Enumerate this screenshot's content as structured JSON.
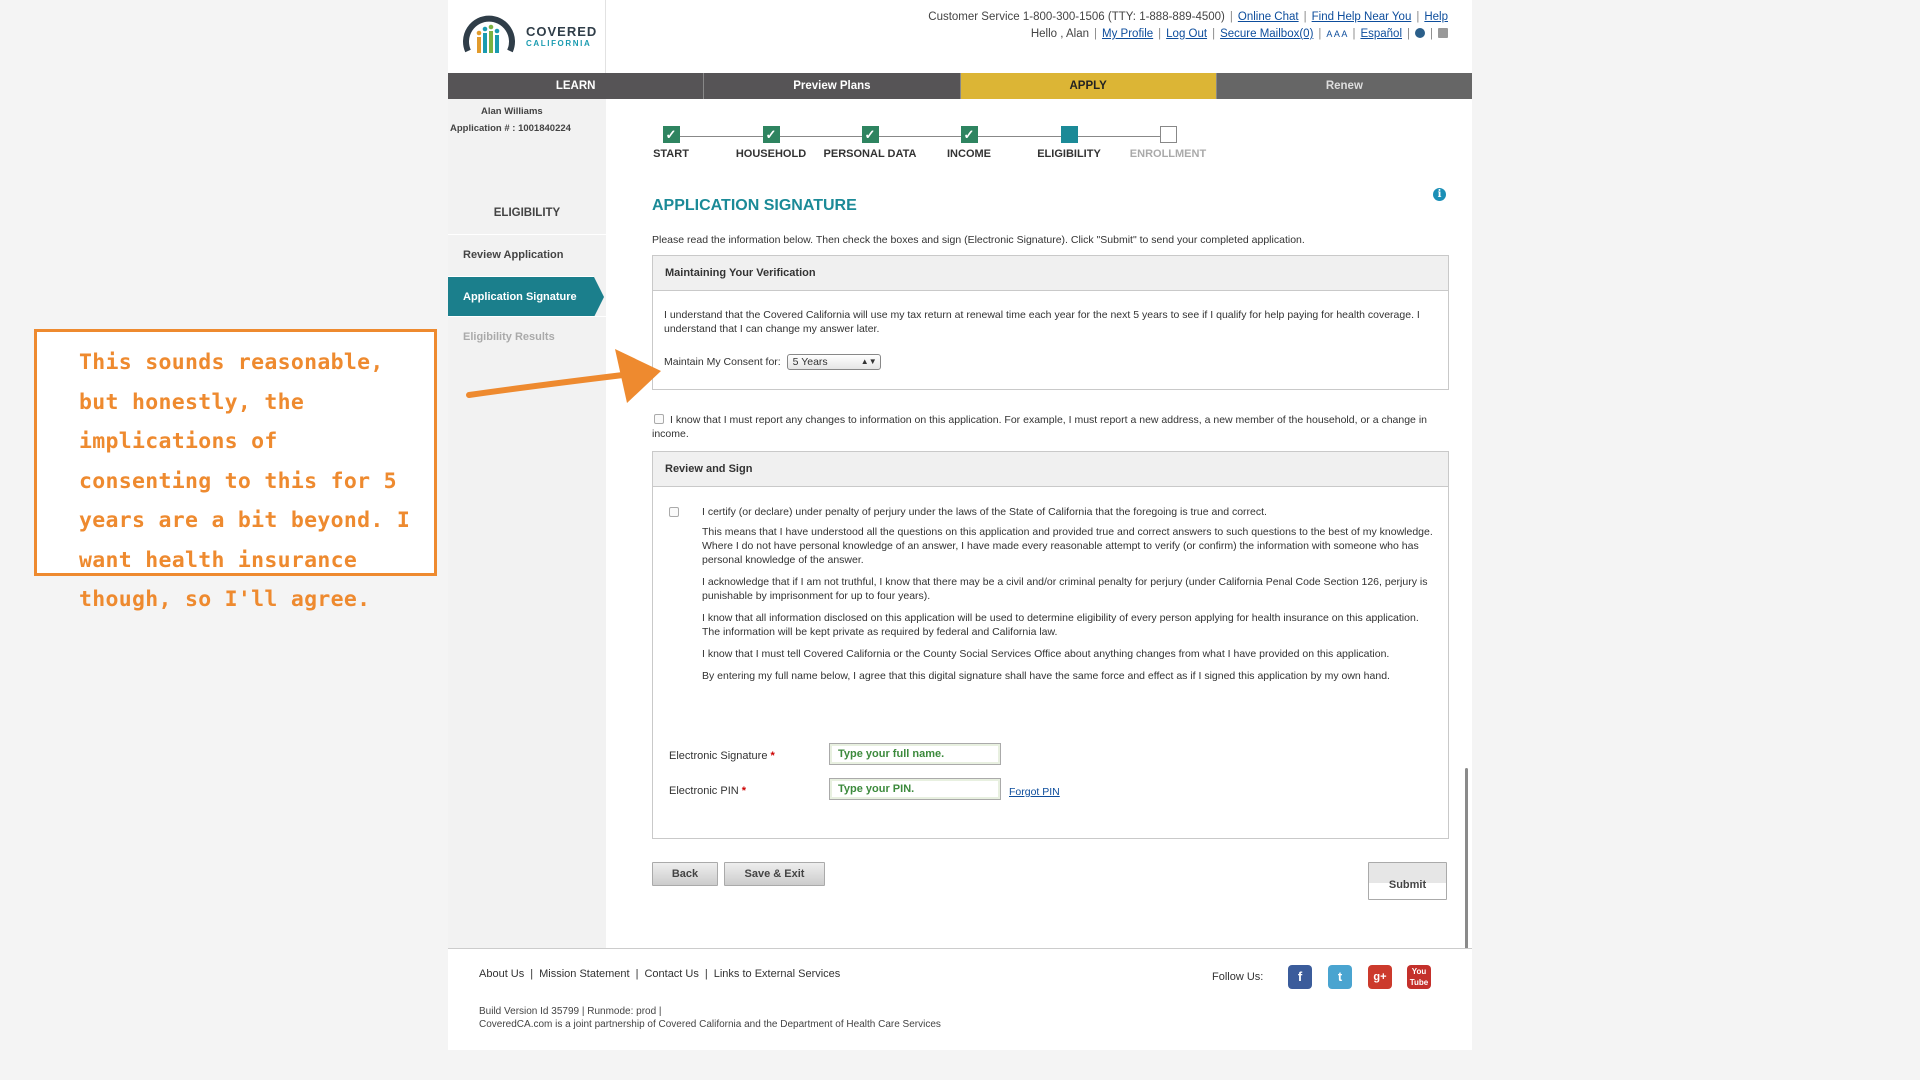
{
  "header": {
    "logo_line1": "COVERED",
    "logo_line2": "CALIFORNIA",
    "customer_service": "Customer Service 1-800-300-1506 (TTY: 1-888-889-4500)",
    "online_chat": "Online Chat",
    "find_help": "Find Help Near You",
    "help": "Help",
    "hello": "Hello , Alan",
    "my_profile": "My Profile",
    "log_out": "Log Out",
    "secure_mailbox": "Secure Mailbox(0)",
    "text_size": "A A A",
    "espanol": "Español"
  },
  "nav": {
    "learn": "LEARN",
    "preview_plans": "Preview Plans",
    "apply": "APPLY",
    "renew": "Renew"
  },
  "sidebar": {
    "user_name": "Alan Williams",
    "application_number": "Application # : 1001840224",
    "heading": "ELIGIBILITY",
    "items": [
      {
        "label": "Review Application",
        "state": "enabled"
      },
      {
        "label": "Application Signature",
        "state": "active"
      },
      {
        "label": "Eligibility Results",
        "state": "disabled"
      }
    ]
  },
  "progress": {
    "steps": [
      {
        "label": "START",
        "status": "complete"
      },
      {
        "label": "HOUSEHOLD",
        "status": "complete"
      },
      {
        "label": "PERSONAL DATA",
        "status": "complete"
      },
      {
        "label": "INCOME",
        "status": "complete"
      },
      {
        "label": "ELIGIBILITY",
        "status": "current"
      },
      {
        "label": "ENROLLMENT",
        "status": "todo"
      }
    ]
  },
  "main": {
    "title": "APPLICATION SIGNATURE",
    "intro": "Please read the information below. Then check the boxes and sign (Electronic Signature). Click \"Submit\" to send your completed application.",
    "verification": {
      "heading": "Maintaining Your Verification",
      "text": "I understand that the Covered California will use my tax return at renewal time each year for the next 5 years to see if I qualify for help paying for health coverage. I understand that I can change my answer later.",
      "consent_label": "Maintain My Consent for:",
      "consent_value": "5 Years"
    },
    "changes_text": "I know that I must report any changes to information on this application. For example, I must report a new address, a new member of the household, or a change in income.",
    "review_sign": {
      "heading": "Review and Sign",
      "paragraphs": [
        "I certify (or declare) under penalty of perjury under the laws of the State of California that the foregoing is true and correct.",
        "This means that I have understood all the questions on this application and provided true and correct answers to such questions to the best of my knowledge. Where I do not have personal knowledge of an answer, I have made every reasonable attempt to verify (or confirm) the information with someone who has personal knowledge of the answer.",
        "I acknowledge that if I am not truthful, I know that there may be a civil and/or criminal penalty for perjury (under California Penal Code Section 126, perjury is punishable by imprisonment for up to four years).",
        "I know that all information disclosed on this application will be used to determine eligibility of every person applying for health insurance on this application. The information will be kept private as required by federal and California law.",
        "I know that I must tell Covered California or the County Social Services Office about anything changes from what I have provided on this application.",
        "By entering my full name below, I agree that this digital signature shall have the same force and effect as if I signed this application by my own hand."
      ],
      "signature_label": "Electronic Signature",
      "signature_placeholder": "Type your full name.",
      "pin_label": "Electronic PIN",
      "pin_placeholder": "Type your PIN.",
      "forgot_pin": "Forgot PIN",
      "required_mark": "*"
    },
    "buttons": {
      "back": "Back",
      "save_exit": "Save & Exit",
      "submit": "Submit"
    }
  },
  "footer": {
    "links": [
      "About Us",
      "Mission Statement",
      "Contact Us",
      "Links to External Services"
    ],
    "build": "Build Version Id 35799 |   Runmode: prod  |",
    "partnership": "CoveredCA.com is a joint partnership of Covered California and the Department of Health Care Services",
    "follow_us": "Follow Us:",
    "social": [
      "facebook-icon",
      "twitter-icon",
      "google-plus-icon",
      "youtube-icon"
    ]
  },
  "annotation": {
    "text": "This sounds reasonable, but honestly, the implications of consenting to this for 5 years are a bit beyond. I want health insurance though, so I'll agree.",
    "color": "#ee8a2f"
  },
  "colors": {
    "accent_teal": "#1b8a97",
    "nav_active": "#dcb535",
    "nav_dark": "#565456",
    "step_complete": "#2e8460"
  }
}
